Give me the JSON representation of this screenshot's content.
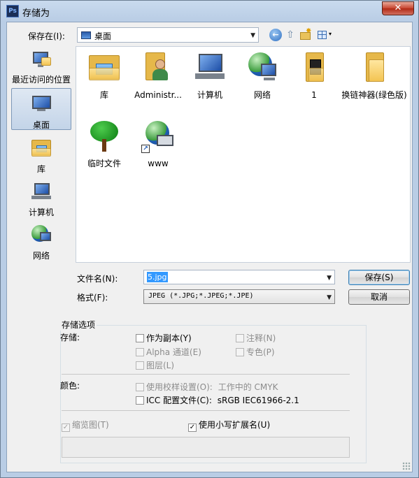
{
  "window": {
    "title": "存储为",
    "app_icon": "Ps",
    "close_glyph": "✕"
  },
  "toolbar": {
    "save_in_label": "保存在(I):",
    "save_in_value": "桌面",
    "back_glyph": "←",
    "up_glyph": "⇧",
    "view_menu_arrow": "▾"
  },
  "places": [
    {
      "label": "最近访问的位置",
      "icon": "recent-places-icon"
    },
    {
      "label": "桌面",
      "icon": "desktop-icon",
      "selected": true
    },
    {
      "label": "库",
      "icon": "libraries-icon"
    },
    {
      "label": "计算机",
      "icon": "computer-icon"
    },
    {
      "label": "网络",
      "icon": "network-icon"
    }
  ],
  "files": [
    {
      "label": "库",
      "icon": "libraries-icon"
    },
    {
      "label": "Administr...",
      "icon": "user-folder-icon"
    },
    {
      "label": "计算机",
      "icon": "computer-icon"
    },
    {
      "label": "网络",
      "icon": "network-icon"
    },
    {
      "label": "1",
      "icon": "folder-icon"
    },
    {
      "label": "换链神器(绿色版)",
      "icon": "folder-icon"
    },
    {
      "label": "临时文件",
      "icon": "tree-icon"
    },
    {
      "label": "www",
      "icon": "network-shortcut-icon"
    }
  ],
  "filename": {
    "label": "文件名(N):",
    "value": "5.jpg"
  },
  "format": {
    "label": "格式(F):",
    "value": "JPEG (*.JPG;*.JPEG;*.JPE)"
  },
  "buttons": {
    "save": "保存(S)",
    "cancel": "取消"
  },
  "options": {
    "group_title": "存储选项",
    "save_label": "存储:",
    "as_copy": {
      "label": "作为副本(Y)",
      "checked": false,
      "enabled": true
    },
    "notes": {
      "label": "注释(N)",
      "checked": false,
      "enabled": false
    },
    "alpha": {
      "label": "Alpha 通道(E)",
      "checked": false,
      "enabled": false
    },
    "spot": {
      "label": "专色(P)",
      "checked": false,
      "enabled": false
    },
    "layers": {
      "label": "图层(L)",
      "checked": false,
      "enabled": false
    },
    "color_label": "颜色:",
    "proof": {
      "label": "使用校样设置(O):",
      "detail": "工作中的 CMYK",
      "checked": false,
      "enabled": false
    },
    "icc": {
      "label": "ICC 配置文件(C):",
      "detail": "sRGB IEC61966-2.1",
      "checked": false,
      "enabled": true
    },
    "thumbnail": {
      "label": "缩览图(T)",
      "checked": true,
      "enabled": false
    },
    "lowercase_ext": {
      "label": "使用小写扩展名(U)",
      "checked": true,
      "enabled": true
    }
  }
}
